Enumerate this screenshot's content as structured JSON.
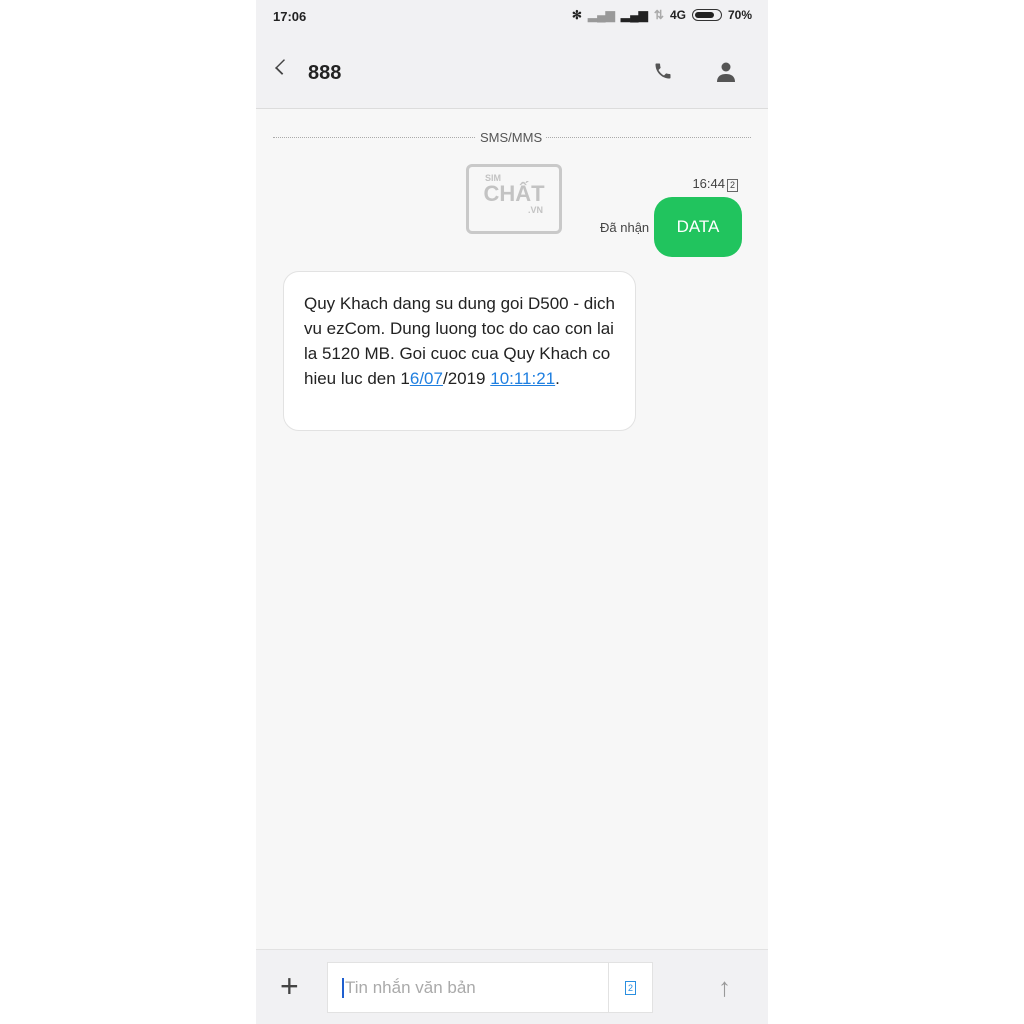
{
  "status_bar": {
    "time": "17:06",
    "network": "4G",
    "battery": "70%",
    "battery_level": 0.7
  },
  "header": {
    "title": "888",
    "icons": [
      "back-icon",
      "phone-icon",
      "contact-icon"
    ]
  },
  "thread": {
    "separator": "SMS/MMS",
    "watermark": "SIM CHẤT .VN",
    "sent": {
      "time": "16:44",
      "sim": "2",
      "status": "Đã nhận",
      "text": "DATA"
    },
    "received": {
      "text_a": "Quy Khach dang su dung goi D500 - dich vu ezCom. Dung luong toc do cao con lai la 5120 MB. Goi cuoc cua Quy Khach co hieu luc den 1",
      "link_date": "6/07",
      "text_b": "/2019 ",
      "link_time": "10:11:21",
      "text_c": "."
    }
  },
  "composer": {
    "placeholder": "Tin nhắn văn bản",
    "sim": "2"
  },
  "colors": {
    "sent_bubble": "#21c45e",
    "link": "#1f7fe0"
  }
}
